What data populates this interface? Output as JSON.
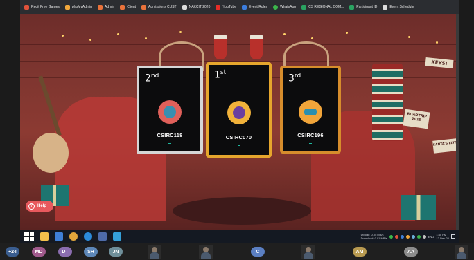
{
  "bookmarks": [
    {
      "label": "Redit Free Games",
      "color": "#e0523b"
    },
    {
      "label": "phpMyAdmin",
      "color": "#f0a73b"
    },
    {
      "label": "Admin",
      "color": "#e9723a"
    },
    {
      "label": "Client",
      "color": "#e9723a"
    },
    {
      "label": "Admissions CUST",
      "color": "#e9723a"
    },
    {
      "label": "NAKCIT 2020",
      "color": "#dcdcdc"
    },
    {
      "label": "YouTube",
      "color": "#e52d27"
    },
    {
      "label": "Event Rules",
      "color": "#3b7ddd"
    },
    {
      "label": "WhatsApp",
      "color": "#3bb54a"
    },
    {
      "label": "CS REGIONAL COM...",
      "color": "#2aa361"
    },
    {
      "label": "Participant ID",
      "color": "#2aa361"
    },
    {
      "label": "Event Schedule",
      "color": "#dcdcdc"
    }
  ],
  "podium": {
    "second": {
      "rank": "2",
      "suffix": "nd",
      "team": "CSIRC118",
      "avatar_bg": "#e0605a",
      "avatar_inner": "#3a8fb0",
      "avatar_icon": "cat-head-icon"
    },
    "first": {
      "rank": "1",
      "suffix": "st",
      "team": "CSIRC070",
      "avatar_bg": "#f1b23a",
      "avatar_inner": "#6b3fa0",
      "avatar_icon": "ice-cream-icon"
    },
    "third": {
      "rank": "3",
      "suffix": "rd",
      "team": "CSIRC196",
      "avatar_bg": "#f1a53a",
      "avatar_inner": "#2b8fb0",
      "avatar_icon": "car-icon"
    }
  },
  "signs": {
    "keys": "KEYS!",
    "roadtrip": "ROADTRIP 2019",
    "santa": "SANTA'S LIST"
  },
  "help": {
    "label": "Help"
  },
  "taskbar": {
    "apps": [
      {
        "name": "folder-app",
        "color": "#f2c04b"
      },
      {
        "name": "file-explorer-app",
        "color": "#3f7fd6"
      },
      {
        "name": "chrome-app",
        "color": "#e2a73b"
      },
      {
        "name": "edge-app",
        "color": "#2b8ad9"
      },
      {
        "name": "store-app",
        "color": "#4e6ba8"
      },
      {
        "name": "photos-app",
        "color": "#35a0d8"
      }
    ],
    "upload": "Upload: 0.05 MB/s",
    "download": "Download: 0.01 MB/s",
    "lang": "ENG",
    "time": "1:45 PM",
    "date": "12-Dec-20"
  },
  "participants": {
    "count": "+24",
    "people": [
      {
        "initials": "MD",
        "color": "#a05a8c"
      },
      {
        "initials": "DT",
        "color": "#8b6db0"
      },
      {
        "initials": "SH",
        "color": "#5d87b8"
      },
      {
        "initials": "JN",
        "color": "#6f8f9a"
      },
      {
        "initials": "C",
        "color": "#5b7fc2"
      },
      {
        "initials": "AM",
        "color": "#b89a50"
      },
      {
        "initials": "AA",
        "color": "#8c8c8c"
      }
    ]
  }
}
